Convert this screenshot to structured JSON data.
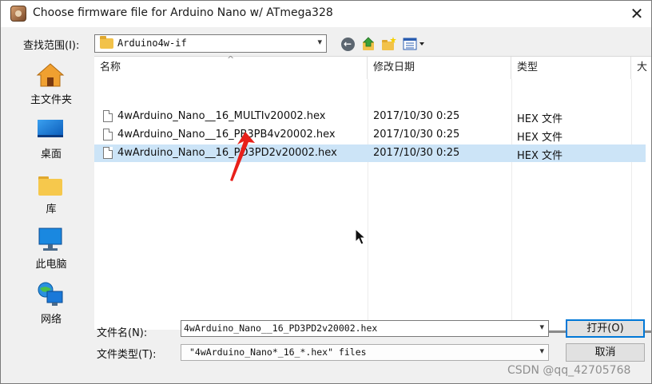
{
  "dialog": {
    "title": "Choose firmware file for Arduino Nano w/ ATmega328",
    "close_glyph": "✕"
  },
  "toolbar": {
    "lookin_label": "查找范围(I):",
    "current_folder": "Arduino4w-if",
    "icons": [
      "back-icon",
      "up-folder-icon",
      "new-folder-icon",
      "view-menu-icon"
    ]
  },
  "places": [
    {
      "label": "主文件夹",
      "icon": "home-icon"
    },
    {
      "label": "桌面",
      "icon": "desktop-icon"
    },
    {
      "label": "库",
      "icon": "library-folder-icon"
    },
    {
      "label": "此电脑",
      "icon": "computer-icon"
    },
    {
      "label": "网络",
      "icon": "network-icon"
    }
  ],
  "columns": {
    "name": "名称",
    "modified": "修改日期",
    "type": "类型",
    "size": "大"
  },
  "files": [
    {
      "name": "4wArduino_Nano__16_MULTIv20002.hex",
      "modified": "2017/10/30 0:25",
      "type": "HEX 文件",
      "selected": false
    },
    {
      "name": "4wArduino_Nano__16_PB3PB4v20002.hex",
      "modified": "2017/10/30 0:25",
      "type": "HEX 文件",
      "selected": false
    },
    {
      "name": "4wArduino_Nano__16_PD3PD2v20002.hex",
      "modified": "2017/10/30 0:25",
      "type": "HEX 文件",
      "selected": true
    }
  ],
  "footer": {
    "filename_label": "文件名(N):",
    "filename_value": "4wArduino_Nano__16_PD3PD2v20002.hex",
    "filetype_label": "文件类型(T):",
    "filetype_value": "\"4wArduino_Nano*_16_*.hex\" files",
    "open_label": "打开(O)",
    "cancel_label": "取消"
  },
  "watermark": "CSDN @qq_42705768",
  "colors": {
    "selection": "#cce4f7",
    "accent": "#0078d7",
    "annotation_arrow": "#e8201a"
  }
}
